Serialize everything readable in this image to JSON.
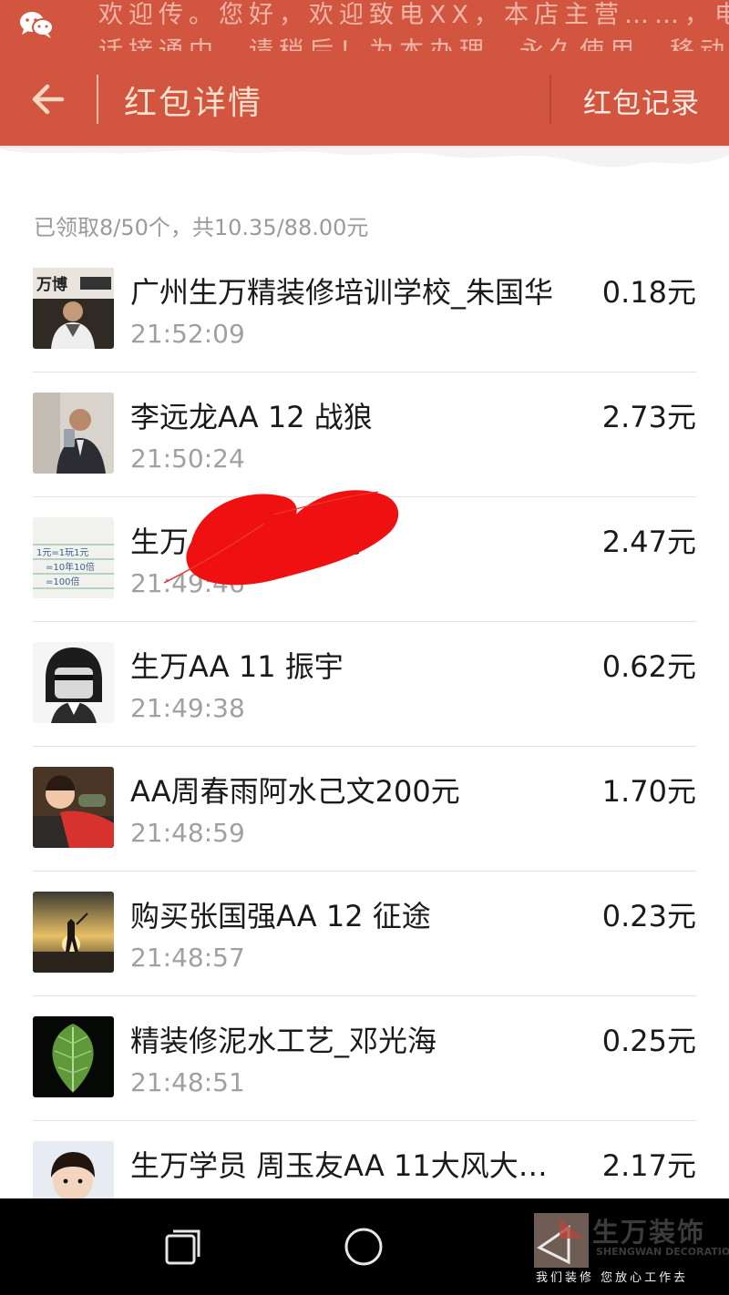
{
  "status_bar": {
    "ticker_line_1": "欢迎传。您好，欢迎致电XX，本店主营……，电",
    "ticker_line_2": "话接通中，请稍后！为本办理，永久使用，移动",
    "icon": "wechat-icon"
  },
  "header": {
    "title": "红包详情",
    "records_label": "红包记录",
    "back_icon": "arrow-left-icon",
    "background": "#d2553f"
  },
  "summary": "已领取8/50个，共10.35/88.00元",
  "recipients": [
    {
      "name": "广州生万精装修培训学校_朱国华",
      "time": "21:52:09",
      "amount": "0.18元"
    },
    {
      "name": "李远龙AA 12  战狼",
      "time": "21:50:24",
      "amount": "2.73元"
    },
    {
      "name": "生万AA 11  一被子",
      "time": "21:49:46",
      "amount": "2.47元"
    },
    {
      "name": "生万AA 11  振宇",
      "time": "21:49:38",
      "amount": "0.62元"
    },
    {
      "name": "AA周春雨阿水己文200元",
      "time": "21:48:59",
      "amount": "1.70元"
    },
    {
      "name": "购买张国强AA  12  征途",
      "time": "21:48:57",
      "amount": "0.23元"
    },
    {
      "name": "精装修泥水工艺_邓光海",
      "time": "21:48:51",
      "amount": "0.25元"
    },
    {
      "name": "生万学员 周玉友AA  11大风大…",
      "time": "",
      "amount": "2.17元"
    }
  ],
  "avatar_1_text": "万博",
  "avatar_3_text_1": "1元=1玩1元",
  "avatar_3_text_2": "=10年10倍",
  "avatar_3_text_3": "=100倍",
  "nav_bar": {
    "recent_icon": "recent-apps-icon",
    "home_icon": "home-circle-icon",
    "back_icon": "triangle-back-icon"
  },
  "watermark": {
    "title": "生万装饰",
    "english": "SHENGWAN DECORATION",
    "slogan": "我们装修 您放心工作去"
  }
}
